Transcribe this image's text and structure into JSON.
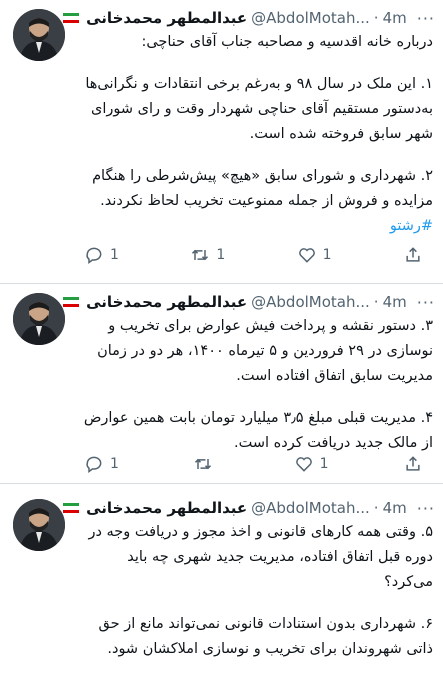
{
  "author": {
    "name": "عبدالمطهر محمدخانی",
    "handle": "@AbdolMotah...",
    "separator": "·",
    "more": "···"
  },
  "tweets": [
    {
      "time": "4m",
      "paragraphs": [
        "درباره خانه اقدسیه و مصاحبه جناب آقای حناچی:",
        "۱. این ملک در سال ۹۸ و به‌رغم برخی انتقادات و نگرانی‌ها به‌دستور مستقیم آقای حناچی شهردار وقت و رای شورای شهر سابق فروخته شده است.",
        "۲. شهرداری و شورای سابق «هیچ» پیش‌شرطی را هنگام مزایده و فروش از جمله ممنوعیت تخریب لحاظ نکردند."
      ],
      "hashtag": "#رشتو",
      "reply_count": "1",
      "retweet_count": "1",
      "like_count": "1"
    },
    {
      "time": "4m",
      "paragraphs": [
        "۳. دستور نقشه و پرداخت فیش عوارض برای تخریب و نوسازی در ۲۹ فروردین و ۵ تیرماه ۱۴۰۰، هر دو در زمان مدیریت سابق اتفاق افتاده است.",
        "۴. مدیریت قبلی مبلغ ۳٫۵ میلیارد تومان بابت همین عوارض از مالک جدید دریافت کرده است."
      ],
      "reply_count": "1",
      "retweet_count": "",
      "like_count": "1"
    },
    {
      "time": "4m",
      "paragraphs": [
        "۵. وقتی همه کارهای قانونی و اخذ مجوز و دریافت وجه در دوره قبل اتفاق افتاده، مدیریت جدید شهری چه باید می‌کرد؟",
        "۶. شهرداری بدون استنادات قانونی نمی‌تواند مانع از حق ذاتی شهروندان برای تخریب و نوسازی املاکشان شود."
      ]
    }
  ],
  "icons": [
    "reply-icon",
    "retweet-icon",
    "like-icon",
    "share-icon",
    "iran-flag-icon"
  ],
  "colors": {
    "link": "#1d9bf0",
    "muted": "#536471",
    "text": "#0f1419",
    "divider": "#d9dde0"
  }
}
